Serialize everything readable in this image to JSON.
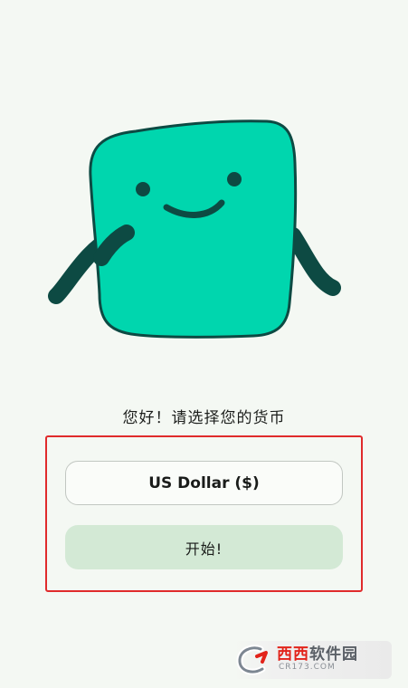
{
  "onboarding": {
    "greeting": "您好！请选择您的货币",
    "currency_selected": "US Dollar ($)",
    "start_button_label": "开始!"
  },
  "watermark": {
    "title_red": "西西",
    "title_grey": "软件园",
    "domain": "CR173.COM"
  },
  "colors": {
    "background": "#f4f8f3",
    "mascot_body": "#00d6ae",
    "mascot_outline": "#0d4a43",
    "start_button_bg": "#d3e9d5",
    "highlight_border": "#e02b2b"
  },
  "icons": {
    "mascot": "smiling-square-mascot-icon",
    "watermark_logo": "cr-logo-icon"
  }
}
